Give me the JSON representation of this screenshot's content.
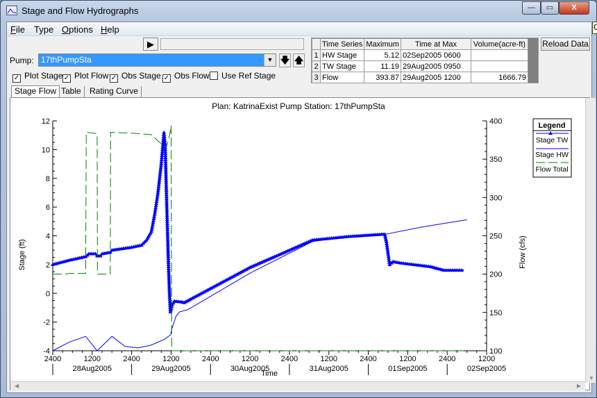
{
  "window": {
    "title": "Stage and Flow Hydrographs",
    "minimize": "—",
    "maximize": "▭",
    "close": "X",
    "tooltip_fragment": "C"
  },
  "menu": {
    "items": [
      {
        "label": "File",
        "accel": "F",
        "rest": "ile"
      },
      {
        "label": "Type",
        "accel": "",
        "rest": "Type"
      },
      {
        "label": "Options",
        "accel": "O",
        "rest": "ptions"
      },
      {
        "label": "Help",
        "accel": "H",
        "rest": "elp"
      }
    ]
  },
  "controls": {
    "play_icon": "▶",
    "pump_label": "Pump:",
    "pump_value": "17thPumpSta",
    "down_icon": "🡇",
    "up_icon": "🡅",
    "checkboxes": [
      {
        "label": "Plot Stage",
        "checked": true
      },
      {
        "label": "Plot Flow",
        "checked": true
      },
      {
        "label": "Obs Stage",
        "checked": true
      },
      {
        "label": "Obs Flow",
        "checked": true
      },
      {
        "label": "Use Ref Stage",
        "checked": false
      }
    ],
    "reload_label": "Reload Data"
  },
  "stats": {
    "headers": [
      "",
      "Time Series",
      "Maximum",
      "Time at Max",
      "Volume(acre-ft)"
    ],
    "rows": [
      [
        "1",
        "HW Stage",
        "5.12",
        "02Sep2005  0600",
        ""
      ],
      [
        "2",
        "TW Stage",
        "11.19",
        "29Aug2005  0950",
        ""
      ],
      [
        "3",
        "Flow",
        "393.87",
        "29Aug2005  1200",
        "1666.79"
      ]
    ]
  },
  "tabs": [
    {
      "label": "Stage Flow",
      "active": true
    },
    {
      "label": "Table",
      "active": false
    },
    {
      "label": "Rating Curve",
      "active": false
    }
  ],
  "chart_data": {
    "type": "line",
    "title": "Plan: KatrinaExist   Pump Station: 17thPumpSta",
    "xlabel": "Time",
    "ylabel": "Stage (ft)",
    "y2label": "Flow (cfs)",
    "ylim": [
      -4,
      12
    ],
    "y2lim": [
      100,
      400
    ],
    "xlim": [
      "2005-08-28 00:00",
      "2005-09-02 12:00"
    ],
    "x_tick_labels": [
      "2400",
      "1200",
      "2400",
      "1200",
      "2400",
      "1200",
      "2400",
      "1200",
      "2400",
      "1200",
      "2400",
      "1200"
    ],
    "date_labels": [
      "28Aug2005",
      "29Aug2005",
      "30Aug2005",
      "31Aug2005",
      "01Sep2005",
      "02Sep2005"
    ],
    "y_ticks": [
      "-4",
      "-2",
      "0",
      "2",
      "4",
      "6",
      "8",
      "10",
      "12"
    ],
    "y2_ticks": [
      "100",
      "150",
      "200",
      "250",
      "300",
      "350",
      "400"
    ],
    "legend": {
      "title": "Legend",
      "position": "right"
    },
    "series": [
      {
        "name": "Stage TW",
        "axis": "left",
        "color": "#0000ff",
        "marker": "triangle",
        "style": "solid",
        "points": [
          [
            "2005-08-28 00:00",
            2.0
          ],
          [
            "2005-08-28 05:00",
            2.3
          ],
          [
            "2005-08-28 10:00",
            2.55
          ],
          [
            "2005-08-28 11:00",
            2.75
          ],
          [
            "2005-08-28 13:00",
            2.75
          ],
          [
            "2005-08-28 13:30",
            2.6
          ],
          [
            "2005-08-28 14:30",
            2.6
          ],
          [
            "2005-08-28 15:00",
            2.75
          ],
          [
            "2005-08-28 17:30",
            2.85
          ],
          [
            "2005-08-28 18:00",
            3.0
          ],
          [
            "2005-08-29 00:00",
            3.2
          ],
          [
            "2005-08-29 03:00",
            3.35
          ],
          [
            "2005-08-29 04:30",
            3.7
          ],
          [
            "2005-08-29 06:00",
            4.3
          ],
          [
            "2005-08-29 07:00",
            5.5
          ],
          [
            "2005-08-29 08:00",
            7.0
          ],
          [
            "2005-08-29 09:00",
            9.0
          ],
          [
            "2005-08-29 09:30",
            10.3
          ],
          [
            "2005-08-29 09:50",
            11.19
          ],
          [
            "2005-08-29 10:12",
            10.3
          ],
          [
            "2005-08-29 10:42",
            6.0
          ],
          [
            "2005-08-29 11:12",
            2.0
          ],
          [
            "2005-08-29 11:30",
            0.0
          ],
          [
            "2005-08-29 11:48",
            -1.3
          ],
          [
            "2005-08-29 12:18",
            -0.8
          ],
          [
            "2005-08-29 13:00",
            -0.55
          ],
          [
            "2005-08-29 15:00",
            -0.6
          ],
          [
            "2005-08-29 16:00",
            -0.65
          ],
          [
            "2005-08-29 18:00",
            -0.4
          ],
          [
            "2005-08-30 12:00",
            1.8
          ],
          [
            "2005-08-31 07:00",
            3.7
          ],
          [
            "2005-08-31 18:00",
            3.95
          ],
          [
            "2005-09-01 04:00",
            4.1
          ],
          [
            "2005-09-01 05:00",
            4.1
          ],
          [
            "2005-09-01 05:30",
            3.6
          ],
          [
            "2005-09-01 06:30",
            2.0
          ],
          [
            "2005-09-01 07:30",
            2.2
          ],
          [
            "2005-09-01 10:00",
            2.1
          ],
          [
            "2005-09-01 19:00",
            1.85
          ],
          [
            "2005-09-01 23:00",
            1.6
          ],
          [
            "2005-09-02 05:00",
            1.6
          ]
        ]
      },
      {
        "name": "Stage HW",
        "axis": "left",
        "color": "#0000ff",
        "marker": "none",
        "style": "solid",
        "points": [
          [
            "2005-08-28 00:00",
            -4.0
          ],
          [
            "2005-08-28 05:00",
            -3.4
          ],
          [
            "2005-08-28 10:00",
            -3.0
          ],
          [
            "2005-08-28 13:30",
            -4.0
          ],
          [
            "2005-08-28 18:00",
            -3.0
          ],
          [
            "2005-08-28 22:00",
            -3.7
          ],
          [
            "2005-08-29 02:00",
            -3.8
          ],
          [
            "2005-08-29 06:00",
            -3.6
          ],
          [
            "2005-08-29 10:00",
            -3.2
          ],
          [
            "2005-08-29 11:48",
            -2.9
          ],
          [
            "2005-08-29 12:12",
            -2.5
          ],
          [
            "2005-08-29 13:30",
            -1.6
          ],
          [
            "2005-08-29 14:30",
            -1.3
          ],
          [
            "2005-08-29 17:00",
            -1.15
          ],
          [
            "2005-08-30 12:00",
            1.4
          ],
          [
            "2005-08-31 07:00",
            3.6
          ],
          [
            "2005-08-31 18:00",
            3.95
          ],
          [
            "2005-09-01 05:00",
            4.1
          ],
          [
            "2005-09-01 16:00",
            4.6
          ],
          [
            "2005-09-02 06:00",
            5.12
          ]
        ]
      },
      {
        "name": "Flow Total",
        "axis": "right",
        "color": "#008000",
        "marker": "none",
        "style": "dashed",
        "points": [
          [
            "2005-08-28 00:00",
            200
          ],
          [
            "2005-08-28 04:00",
            200
          ],
          [
            "2005-08-28 05:00",
            201
          ],
          [
            "2005-08-28 10:00",
            201
          ],
          [
            "2005-08-28 10:12",
            385
          ],
          [
            "2005-08-28 12:30",
            384
          ],
          [
            "2005-08-28 13:30",
            383
          ],
          [
            "2005-08-28 13:36",
            200
          ],
          [
            "2005-08-28 17:30",
            200
          ],
          [
            "2005-08-28 17:36",
            385
          ],
          [
            "2005-08-29 00:00",
            384
          ],
          [
            "2005-08-29 06:00",
            382
          ],
          [
            "2005-08-29 08:30",
            372
          ],
          [
            "2005-08-29 10:30",
            365
          ],
          [
            "2005-08-29 11:30",
            380
          ],
          [
            "2005-08-29 12:00",
            393.87
          ],
          [
            "2005-08-29 12:12",
            100
          ],
          [
            "2005-09-02 05:00",
            100
          ]
        ]
      }
    ]
  }
}
